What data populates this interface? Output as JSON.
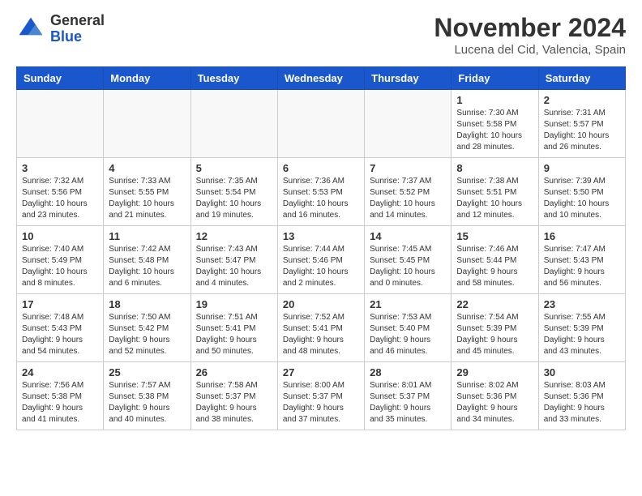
{
  "header": {
    "logo_general": "General",
    "logo_blue": "Blue",
    "month_title": "November 2024",
    "location": "Lucena del Cid, Valencia, Spain"
  },
  "weekdays": [
    "Sunday",
    "Monday",
    "Tuesday",
    "Wednesday",
    "Thursday",
    "Friday",
    "Saturday"
  ],
  "weeks": [
    [
      {
        "day": "",
        "info": ""
      },
      {
        "day": "",
        "info": ""
      },
      {
        "day": "",
        "info": ""
      },
      {
        "day": "",
        "info": ""
      },
      {
        "day": "",
        "info": ""
      },
      {
        "day": "1",
        "info": "Sunrise: 7:30 AM\nSunset: 5:58 PM\nDaylight: 10 hours and 28 minutes."
      },
      {
        "day": "2",
        "info": "Sunrise: 7:31 AM\nSunset: 5:57 PM\nDaylight: 10 hours and 26 minutes."
      }
    ],
    [
      {
        "day": "3",
        "info": "Sunrise: 7:32 AM\nSunset: 5:56 PM\nDaylight: 10 hours and 23 minutes."
      },
      {
        "day": "4",
        "info": "Sunrise: 7:33 AM\nSunset: 5:55 PM\nDaylight: 10 hours and 21 minutes."
      },
      {
        "day": "5",
        "info": "Sunrise: 7:35 AM\nSunset: 5:54 PM\nDaylight: 10 hours and 19 minutes."
      },
      {
        "day": "6",
        "info": "Sunrise: 7:36 AM\nSunset: 5:53 PM\nDaylight: 10 hours and 16 minutes."
      },
      {
        "day": "7",
        "info": "Sunrise: 7:37 AM\nSunset: 5:52 PM\nDaylight: 10 hours and 14 minutes."
      },
      {
        "day": "8",
        "info": "Sunrise: 7:38 AM\nSunset: 5:51 PM\nDaylight: 10 hours and 12 minutes."
      },
      {
        "day": "9",
        "info": "Sunrise: 7:39 AM\nSunset: 5:50 PM\nDaylight: 10 hours and 10 minutes."
      }
    ],
    [
      {
        "day": "10",
        "info": "Sunrise: 7:40 AM\nSunset: 5:49 PM\nDaylight: 10 hours and 8 minutes."
      },
      {
        "day": "11",
        "info": "Sunrise: 7:42 AM\nSunset: 5:48 PM\nDaylight: 10 hours and 6 minutes."
      },
      {
        "day": "12",
        "info": "Sunrise: 7:43 AM\nSunset: 5:47 PM\nDaylight: 10 hours and 4 minutes."
      },
      {
        "day": "13",
        "info": "Sunrise: 7:44 AM\nSunset: 5:46 PM\nDaylight: 10 hours and 2 minutes."
      },
      {
        "day": "14",
        "info": "Sunrise: 7:45 AM\nSunset: 5:45 PM\nDaylight: 10 hours and 0 minutes."
      },
      {
        "day": "15",
        "info": "Sunrise: 7:46 AM\nSunset: 5:44 PM\nDaylight: 9 hours and 58 minutes."
      },
      {
        "day": "16",
        "info": "Sunrise: 7:47 AM\nSunset: 5:43 PM\nDaylight: 9 hours and 56 minutes."
      }
    ],
    [
      {
        "day": "17",
        "info": "Sunrise: 7:48 AM\nSunset: 5:43 PM\nDaylight: 9 hours and 54 minutes."
      },
      {
        "day": "18",
        "info": "Sunrise: 7:50 AM\nSunset: 5:42 PM\nDaylight: 9 hours and 52 minutes."
      },
      {
        "day": "19",
        "info": "Sunrise: 7:51 AM\nSunset: 5:41 PM\nDaylight: 9 hours and 50 minutes."
      },
      {
        "day": "20",
        "info": "Sunrise: 7:52 AM\nSunset: 5:41 PM\nDaylight: 9 hours and 48 minutes."
      },
      {
        "day": "21",
        "info": "Sunrise: 7:53 AM\nSunset: 5:40 PM\nDaylight: 9 hours and 46 minutes."
      },
      {
        "day": "22",
        "info": "Sunrise: 7:54 AM\nSunset: 5:39 PM\nDaylight: 9 hours and 45 minutes."
      },
      {
        "day": "23",
        "info": "Sunrise: 7:55 AM\nSunset: 5:39 PM\nDaylight: 9 hours and 43 minutes."
      }
    ],
    [
      {
        "day": "24",
        "info": "Sunrise: 7:56 AM\nSunset: 5:38 PM\nDaylight: 9 hours and 41 minutes."
      },
      {
        "day": "25",
        "info": "Sunrise: 7:57 AM\nSunset: 5:38 PM\nDaylight: 9 hours and 40 minutes."
      },
      {
        "day": "26",
        "info": "Sunrise: 7:58 AM\nSunset: 5:37 PM\nDaylight: 9 hours and 38 minutes."
      },
      {
        "day": "27",
        "info": "Sunrise: 8:00 AM\nSunset: 5:37 PM\nDaylight: 9 hours and 37 minutes."
      },
      {
        "day": "28",
        "info": "Sunrise: 8:01 AM\nSunset: 5:37 PM\nDaylight: 9 hours and 35 minutes."
      },
      {
        "day": "29",
        "info": "Sunrise: 8:02 AM\nSunset: 5:36 PM\nDaylight: 9 hours and 34 minutes."
      },
      {
        "day": "30",
        "info": "Sunrise: 8:03 AM\nSunset: 5:36 PM\nDaylight: 9 hours and 33 minutes."
      }
    ]
  ]
}
